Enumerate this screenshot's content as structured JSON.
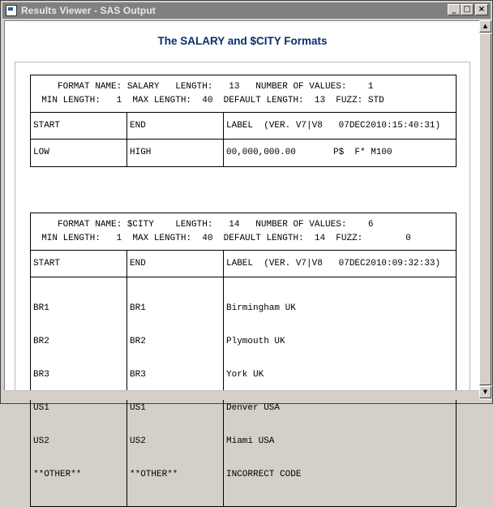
{
  "window": {
    "title": "Results Viewer - SAS Output",
    "minimize_glyph": "_",
    "maximize_glyph": "□",
    "close_glyph": "×"
  },
  "report": {
    "title": "The SALARY and $CITY Formats"
  },
  "formats": [
    {
      "header_line1": "     FORMAT NAME: SALARY   LENGTH:   13   NUMBER OF VALUES:    1",
      "header_line2": "  MIN LENGTH:   1  MAX LENGTH:  40  DEFAULT LENGTH:  13  FUZZ: STD",
      "col_start": "START",
      "col_end": "END",
      "col_label": "LABEL  (VER. V7|V8   07DEC2010:15:40:31)",
      "rows": [
        {
          "start": "LOW",
          "end": "HIGH",
          "label": "00,000,000.00       P$  F* M100"
        }
      ]
    },
    {
      "header_line1": "     FORMAT NAME: $CITY    LENGTH:   14   NUMBER OF VALUES:    6",
      "header_line2": "  MIN LENGTH:   1  MAX LENGTH:  40  DEFAULT LENGTH:  14  FUZZ:        0",
      "col_start": "START",
      "col_end": "END",
      "col_label": "LABEL  (VER. V7|V8   07DEC2010:09:32:33)",
      "rows": [
        {
          "start": "BR1",
          "end": "BR1",
          "label": "Birmingham UK"
        },
        {
          "start": "BR2",
          "end": "BR2",
          "label": "Plymouth UK"
        },
        {
          "start": "BR3",
          "end": "BR3",
          "label": "York UK"
        },
        {
          "start": "US1",
          "end": "US1",
          "label": "Denver USA"
        },
        {
          "start": "US2",
          "end": "US2",
          "label": "Miami USA"
        },
        {
          "start": "**OTHER**",
          "end": "**OTHER**",
          "label": "INCORRECT CODE"
        }
      ]
    }
  ]
}
